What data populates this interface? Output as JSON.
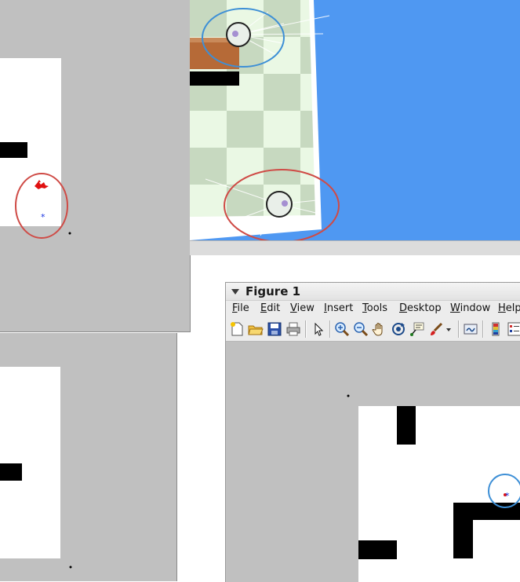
{
  "figure": {
    "title": "Figure 1",
    "menu": [
      {
        "mnemonic": "F",
        "rest": "ile"
      },
      {
        "mnemonic": "E",
        "rest": "dit"
      },
      {
        "mnemonic": "V",
        "rest": "iew"
      },
      {
        "mnemonic": "I",
        "rest": "nsert"
      },
      {
        "mnemonic": "T",
        "rest": "ools"
      },
      {
        "mnemonic": "D",
        "rest": "esktop"
      },
      {
        "mnemonic": "W",
        "rest": "indow"
      },
      {
        "mnemonic": "H",
        "rest": "elp"
      }
    ],
    "toolbar_icons": [
      "new-figure-icon",
      "open-file-icon",
      "save-icon",
      "print-icon",
      "edit-plot-arrow-icon",
      "zoom-in-icon",
      "zoom-out-icon",
      "pan-hand-icon",
      "rotate-3d-icon",
      "data-cursor-icon",
      "brush-icon",
      "brush-dropdown-icon",
      "link-plot-icon",
      "colorbar-icon",
      "legend-icon"
    ]
  },
  "colors": {
    "occupancy_grey": "#c0c0c0",
    "free_white": "#ffffff",
    "obstacle_black": "#000000",
    "sim_sky_blue": "#4f98f2",
    "checker_light": "#eaf8e4",
    "checker_dark": "#c7d9c0",
    "box_wood": "#b66a37",
    "highlight_red": "#cf4b46",
    "highlight_blue": "#3d8fd6",
    "particles_red": "#e01010",
    "estimate_blue": "#1530e0"
  }
}
